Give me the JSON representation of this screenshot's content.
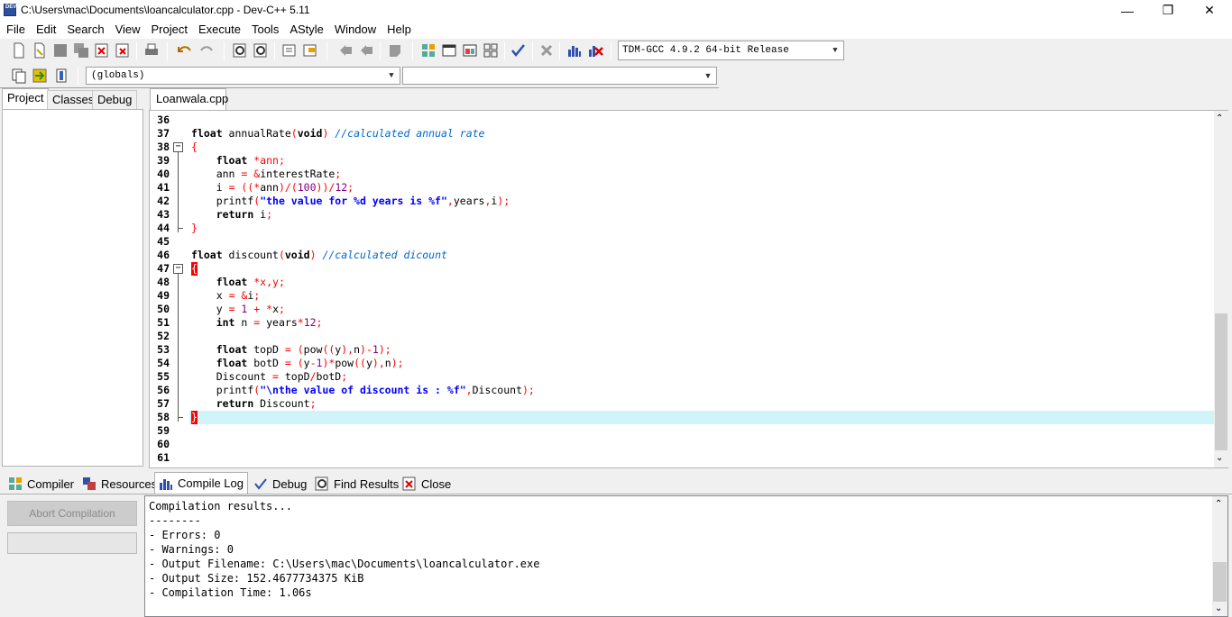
{
  "window": {
    "title": "C:\\Users\\mac\\Documents\\loancalculator.cpp - Dev-C++ 5.11",
    "app_icon_text": "DEV",
    "controls": {
      "minimize": "—",
      "restore": "❐",
      "close": "✕"
    }
  },
  "menu": [
    "File",
    "Edit",
    "Search",
    "View",
    "Project",
    "Execute",
    "Tools",
    "AStyle",
    "Window",
    "Help"
  ],
  "toolbar": {
    "compiler": "TDM-GCC 4.9.2 64-bit Release",
    "scope": "(globals)",
    "function": ""
  },
  "left_panel": {
    "tabs": [
      "Project",
      "Classes",
      "Debug"
    ],
    "active_tab": "Project"
  },
  "editor": {
    "tab": "Loanwala.cpp",
    "current_line": 58,
    "lines": [
      {
        "n": "36"
      },
      {
        "n": "37"
      },
      {
        "n": "38"
      },
      {
        "n": "39"
      },
      {
        "n": "40"
      },
      {
        "n": "41"
      },
      {
        "n": "42"
      },
      {
        "n": "43"
      },
      {
        "n": "44"
      },
      {
        "n": "45"
      },
      {
        "n": "46"
      },
      {
        "n": "47"
      },
      {
        "n": "48"
      },
      {
        "n": "49"
      },
      {
        "n": "50"
      },
      {
        "n": "51"
      },
      {
        "n": "52"
      },
      {
        "n": "53"
      },
      {
        "n": "54"
      },
      {
        "n": "55"
      },
      {
        "n": "56"
      },
      {
        "n": "57"
      },
      {
        "n": "58"
      },
      {
        "n": "59"
      },
      {
        "n": "60"
      },
      {
        "n": "61"
      }
    ],
    "code": {
      "l37_kw": "float",
      "l37_name": " annualRate",
      "l37_p1": "(",
      "l37_void": "void",
      "l37_p2": ")",
      "l37_cm": " //calculated annual rate",
      "l38": "{",
      "l39_kw": "float",
      "l39_rest": " *ann;",
      "l40_a": "ann",
      "l40_b": " = &",
      "l40_c": "interestRate",
      "l40_d": ";",
      "l41_a": "i",
      "l41_b": " = ((*",
      "l41_c": "ann",
      "l41_d": ")/(",
      "l41_e": "100",
      "l41_f": "))/",
      "l41_g": "12",
      "l41_h": ";",
      "l42_a": "printf",
      "l42_b": "(",
      "l42_s": "\"the value for %d years is %f\"",
      "l42_c": ",",
      "l42_d": "years",
      "l42_e": ",",
      "l42_f": "i",
      "l42_g": ");",
      "l43_kw": "return",
      "l43_a": " i",
      "l43_b": ";",
      "l44": "}",
      "l46_kw": "float",
      "l46_name": " discount",
      "l46_p1": "(",
      "l46_void": "void",
      "l46_p2": ")",
      "l46_cm": " //calculated dicount",
      "l47": "{",
      "l48_kw": "float",
      "l48_rest": " *x,y;",
      "l49_a": "x",
      "l49_b": " = &",
      "l49_c": "i",
      "l49_d": ";",
      "l50_a": "y",
      "l50_b": " = ",
      "l50_c": "1",
      "l50_d": " + *",
      "l50_e": "x",
      "l50_f": ";",
      "l51_kw": "int",
      "l51_a": " n",
      "l51_b": " = ",
      "l51_c": "years",
      "l51_d": "*",
      "l51_e": "12",
      "l51_f": ";",
      "l53_kw": "float",
      "l53_a": " topD",
      "l53_b": " = (",
      "l53_c": "pow",
      "l53_d": "((",
      "l53_e": "y",
      "l53_f": "),",
      "l53_g": "n",
      "l53_h": ")-",
      "l53_i": "1",
      "l53_j": ");",
      "l54_kw": "float",
      "l54_a": " botD",
      "l54_b": " = (",
      "l54_c": "y",
      "l54_d": "-",
      "l54_e": "1",
      "l54_f": ")*",
      "l54_g": "pow",
      "l54_h": "((",
      "l54_i": "y",
      "l54_j": "),",
      "l54_k": "n",
      "l54_l": ");",
      "l55_a": "Discount",
      "l55_b": " = ",
      "l55_c": "topD",
      "l55_d": "/",
      "l55_e": "botD",
      "l55_f": ";",
      "l56_a": "printf",
      "l56_b": "(",
      "l56_s": "\"\\nthe value of discount is : %f\"",
      "l56_c": ",",
      "l56_d": "Discount",
      "l56_e": ");",
      "l57_kw": "return",
      "l57_a": " Discount",
      "l57_b": ";",
      "l58": "}"
    }
  },
  "bottom_tabs": [
    "Compiler",
    "Resources",
    "Compile Log",
    "Debug",
    "Find Results",
    "Close"
  ],
  "bottom_active": "Compile Log",
  "compile": {
    "abort_label": "Abort Compilation",
    "log": [
      "Compilation results...",
      "--------",
      "- Errors: 0",
      "- Warnings: 0",
      "- Output Filename: C:\\Users\\mac\\Documents\\loancalculator.exe",
      "- Output Size: 152.4677734375 KiB",
      "- Compilation Time: 1.06s"
    ]
  }
}
